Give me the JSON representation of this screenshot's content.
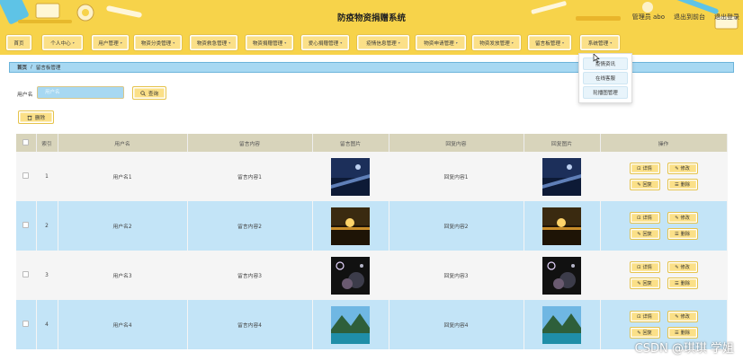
{
  "header": {
    "title": "防疫物资捐赠系统",
    "links": [
      "管理员 abo",
      "退出到前台",
      "退出登录"
    ]
  },
  "nav": [
    {
      "label": "首页",
      "caret": false
    },
    {
      "label": "个人中心",
      "caret": true
    },
    {
      "label": "用户管理",
      "caret": true
    },
    {
      "label": "物资分类管理",
      "caret": true
    },
    {
      "label": "物资救急管理",
      "caret": true
    },
    {
      "label": "物资捐赠管理",
      "caret": true
    },
    {
      "label": "爱心捐赠管理",
      "caret": true
    },
    {
      "label": "疫情信息管理",
      "caret": true
    },
    {
      "label": "物资申请管理",
      "caret": true
    },
    {
      "label": "物资发放管理",
      "caret": true
    },
    {
      "label": "留言板管理",
      "caret": true
    },
    {
      "label": "系统管理",
      "caret": true
    }
  ],
  "dropdown": [
    "疫情资讯",
    "在线客服",
    "轮播图管理"
  ],
  "breadcrumb": {
    "home": "首页",
    "sep": "/",
    "current": "留言板管理"
  },
  "search": {
    "label": "用户名",
    "placeholder": "用户名",
    "button": "查询"
  },
  "delete_button": "删除",
  "table": {
    "headers": [
      "索引",
      "用户名",
      "留言内容",
      "留言图片",
      "回复内容",
      "回复图片",
      "操作"
    ],
    "rows": [
      {
        "index": "1",
        "user": "用户名1",
        "message": "留言内容1",
        "reply": "回复内容1"
      },
      {
        "index": "2",
        "user": "用户名2",
        "message": "留言内容2",
        "reply": "回复内容2"
      },
      {
        "index": "3",
        "user": "用户名3",
        "message": "留言内容3",
        "reply": "回复内容3"
      },
      {
        "index": "4",
        "user": "用户名4",
        "message": "留言内容4",
        "reply": "回复内容4"
      }
    ],
    "ops": [
      "详情",
      "修改",
      "回复",
      "删除"
    ]
  },
  "watermark": "CSDN @琪琪 学姐",
  "colors": {
    "accent": "#f7d34a",
    "button": "#fbe088",
    "row_alt": "#c3e4f7",
    "header_row": "#d8d4bb"
  }
}
